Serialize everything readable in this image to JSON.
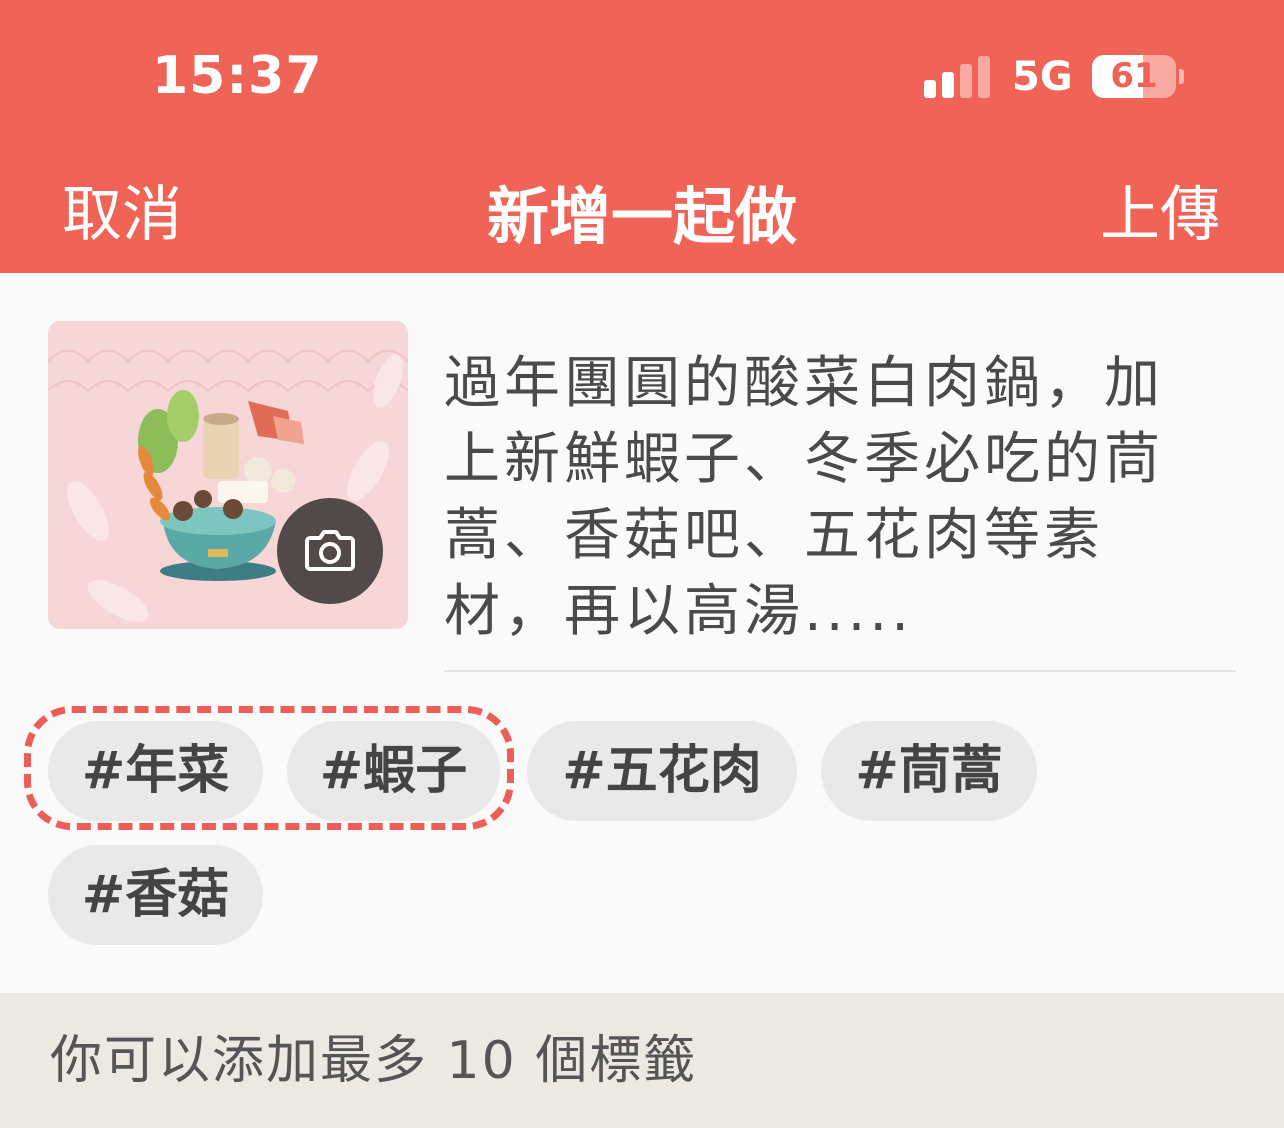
{
  "status_bar": {
    "time": "15:37",
    "network": "5G",
    "battery": "61",
    "battery_level_percent": 61
  },
  "nav": {
    "cancel_label": "取消",
    "title": "新增一起做",
    "upload_label": "上傳"
  },
  "post": {
    "description": "過年團圓的酸菜白肉鍋，加上新鮮蝦子、冬季必吃的茼蒿、香菇吧、五花肉等素材，再以高湯....."
  },
  "tags": [
    {
      "label": "#年菜",
      "highlighted": true
    },
    {
      "label": "#蝦子",
      "highlighted": true
    },
    {
      "label": "#五花肉",
      "highlighted": false
    },
    {
      "label": "#茼蒿",
      "highlighted": false
    },
    {
      "label": "#香菇",
      "highlighted": false
    }
  ],
  "footer": {
    "note": "你可以添加最多 10 個標籤"
  },
  "colors": {
    "accent": "#f06457",
    "highlight": "#ec5e57",
    "tag_bg": "#e9e9e9",
    "footer_bg": "#ece8e2"
  },
  "icons": [
    "signal-icon",
    "camera-icon"
  ]
}
